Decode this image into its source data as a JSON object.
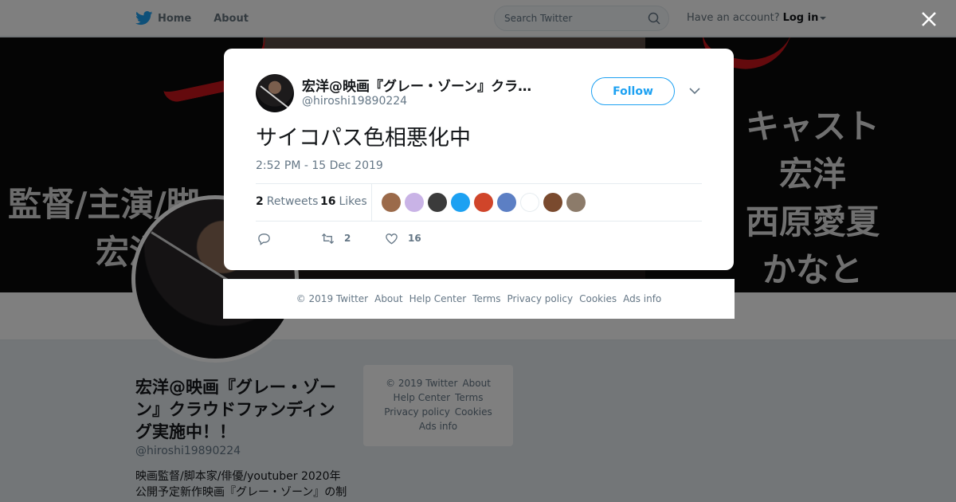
{
  "topbar": {
    "nav": [
      "Home",
      "About"
    ],
    "search_placeholder": "Search Twitter",
    "account_prompt": "Have an account?",
    "login_label": "Log in"
  },
  "banner": {
    "left_lines": [
      "監督/主演/脚",
      "宏洋"
    ],
    "right_lines": [
      "キャスト",
      "宏洋",
      "西原愛夏",
      "かなと"
    ]
  },
  "profile": {
    "name": "宏洋@映画『グレー・ゾーン』クラウドファンディング実施中！！",
    "handle": "@hiroshi19890224",
    "bio": "映画監督/脚本家/俳優/youtuber 2020年公開予定新作映画『グレー・ゾーン』の制"
  },
  "side_footer": {
    "links": [
      "© 2019 Twitter",
      "About",
      "Help Center",
      "Terms",
      "Privacy policy",
      "Cookies",
      "Ads info"
    ]
  },
  "tweet": {
    "author_name": "宏洋@映画『グレー・ゾーン』クラ…",
    "author_handle": "@hiroshi19890224",
    "follow_label": "Follow",
    "text": "サイコパス色相悪化中",
    "timestamp": "2:52 PM - 15 Dec 2019",
    "retweets_count": "2",
    "retweets_label": "Retweets",
    "likes_count": "16",
    "likes_label": "Likes",
    "liker_avatar_colors": [
      "#9b6a4a",
      "#c9b3e6",
      "#3b3b3b",
      "#1da1f2",
      "#d0452a",
      "#5c7fc4",
      "#ffffff",
      "#7a4a2e",
      "#8c7b6a"
    ],
    "action_retweet_count": "2",
    "action_like_count": "16"
  },
  "modal_footer": {
    "links": [
      "© 2019 Twitter",
      "About",
      "Help Center",
      "Terms",
      "Privacy policy",
      "Cookies",
      "Ads info"
    ]
  },
  "colors": {
    "brand": "#1da1f2",
    "overlay": "rgba(0,0,0,0.5)",
    "text_secondary": "#657786"
  }
}
